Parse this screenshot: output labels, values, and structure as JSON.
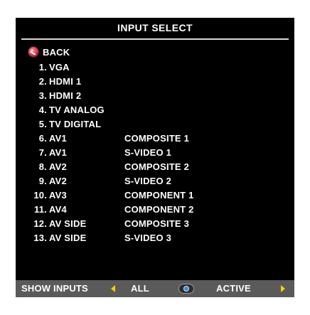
{
  "menu": {
    "title": "INPUT SELECT",
    "back_label": "BACK",
    "back_icon": "back-icon"
  },
  "inputs": [
    {
      "num": "1.",
      "name": "VGA",
      "type": ""
    },
    {
      "num": "2.",
      "name": "HDMI 1",
      "type": ""
    },
    {
      "num": "3.",
      "name": "HDMI 2",
      "type": ""
    },
    {
      "num": "4.",
      "name": "TV ANALOG",
      "type": ""
    },
    {
      "num": "5.",
      "name": "TV DIGITAL",
      "type": ""
    },
    {
      "num": "6.",
      "name": "AV1",
      "type": "COMPOSITE 1"
    },
    {
      "num": "7.",
      "name": "AV1",
      "type": "S-VIDEO 1"
    },
    {
      "num": "8.",
      "name": "AV2",
      "type": "COMPOSITE 2"
    },
    {
      "num": "9.",
      "name": "AV2",
      "type": "S-VIDEO 2"
    },
    {
      "num": "10.",
      "name": "AV3",
      "type": "COMPONENT 1"
    },
    {
      "num": "11.",
      "name": "AV4",
      "type": "COMPONENT 2"
    },
    {
      "num": "12.",
      "name": "AV SIDE",
      "type": "COMPOSITE 3"
    },
    {
      "num": "13.",
      "name": "AV SIDE",
      "type": "S-VIDEO 3"
    }
  ],
  "bottom": {
    "show_inputs_label": "SHOW INPUTS",
    "all_label": "ALL",
    "active_label": "ACTIVE",
    "arrow_color": "#f0d000",
    "bar_color": "#5a5a5a"
  }
}
